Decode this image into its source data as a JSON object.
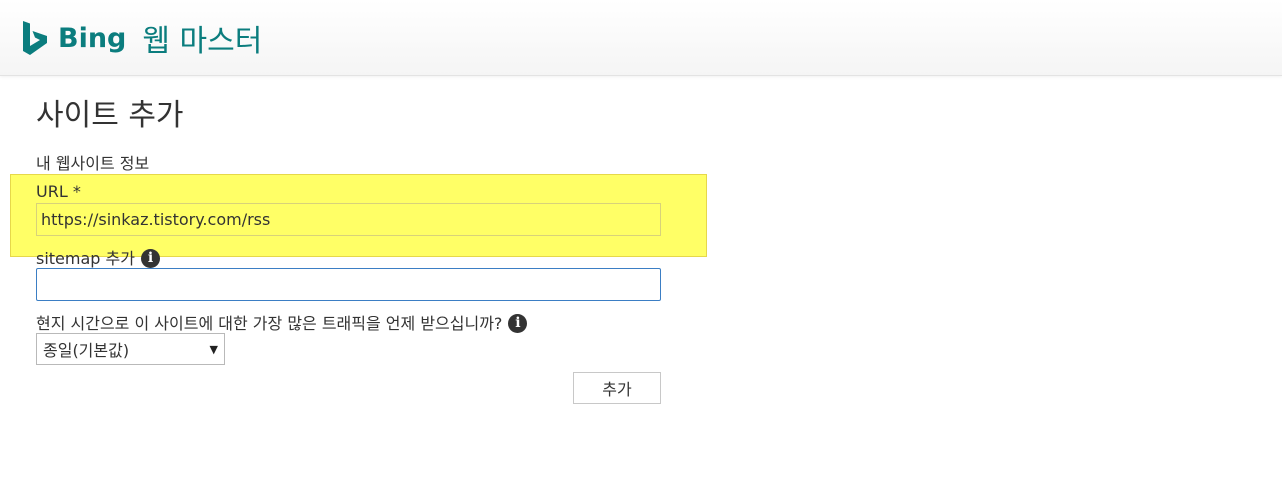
{
  "header": {
    "brand": "Bing",
    "product": "웹 마스터",
    "brand_color": "#0b7d7e"
  },
  "page": {
    "title": "사이트 추가",
    "section_title": "내 웹사이트 정보"
  },
  "form": {
    "url_label": "URL *",
    "url_value": "https://sinkaz.tistory.com/rss",
    "sitemap_label": "sitemap 추가",
    "sitemap_value": "",
    "traffic_label": "현지 시간으로 이 사이트에 대한 가장 많은 트래픽을 언제 받으십니까?",
    "traffic_selected": "종일(기본값)",
    "submit_label": "추가"
  },
  "icons": {
    "logo": "bing-logo-icon",
    "info": "info-icon",
    "dropdown": "chevron-down-icon"
  },
  "colors": {
    "highlight": "#ffff66",
    "focus_border": "#3b7ec4"
  }
}
